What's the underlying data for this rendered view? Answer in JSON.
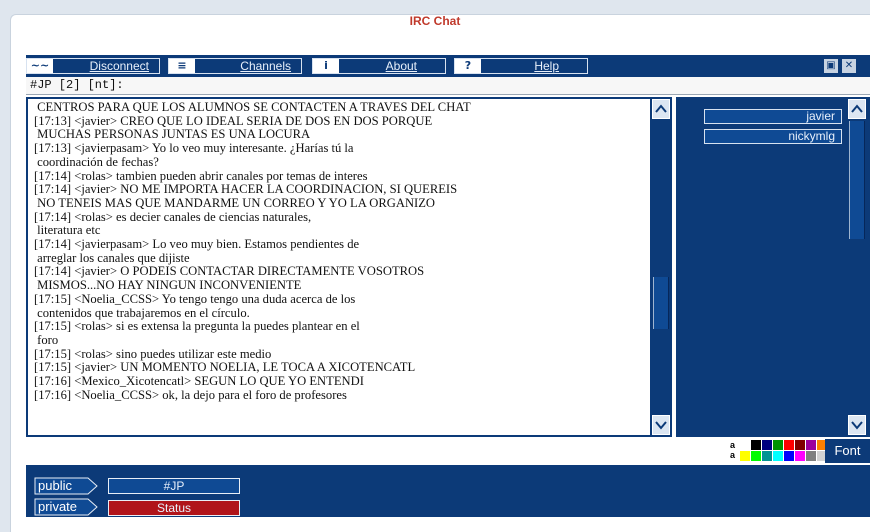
{
  "app": {
    "title": "IRC Chat"
  },
  "toolbar": {
    "disconnect": {
      "label": "Disconnect",
      "glyph": "~~"
    },
    "channels": {
      "label": "Channels",
      "glyph": "≡"
    },
    "about": {
      "label": "About",
      "glyph": "i"
    },
    "help": {
      "label": "Help",
      "glyph": "?"
    },
    "restore_glyph": "▣",
    "close_glyph": "✕"
  },
  "channel_bar": {
    "text": "#JP [2] [nt]:"
  },
  "messages": [
    " CENTROS PARA QUE LOS ALUMNOS SE CONTACTEN A TRAVES DEL CHAT",
    "[17:13] <javier> CREO QUE LO IDEAL SERIA DE DOS EN DOS PORQUE",
    " MUCHAS PERSONAS JUNTAS ES UNA LOCURA",
    "[17:13] <javierpasam> Yo lo veo muy interesante. ¿Harías tú la",
    " coordinación de fechas?",
    "[17:14] <rolas> tambien pueden abrir canales por temas de interes",
    "[17:14] <javier> NO ME IMPORTA HACER LA COORDINACION, SI QUEREIS",
    " NO TENEIS MAS QUE MANDARME UN CORREO Y YO LA ORGANIZO",
    "[17:14] <rolas> es decier canales de ciencias naturales,",
    " literatura etc",
    "[17:14] <javierpasam> Lo veo muy bien. Estamos pendientes de",
    " arreglar los canales que dijiste",
    "[17:14] <javier> O PODEIS CONTACTAR DIRECTAMENTE VOSOTROS",
    " MISMOS...NO HAY NINGUN INCONVENIENTE",
    "[17:15] <Noelia_CCSS> Yo tengo tengo una duda acerca de los",
    " contenidos que trabajaremos en el círculo.",
    "[17:15] <rolas> si es extensa la pregunta la puedes plantear en el",
    " foro",
    "[17:15] <rolas> sino puedes utilizar este medio",
    "[17:15] <javier> UN MOMENTO NOELIA, LE TOCA A XICOTENCATL",
    "[17:16] <Mexico_Xicotencatl> SEGUN LO QUE YO ENTENDI",
    "[17:16] <Noelia_CCSS> ok, la dejo para el foro de profesores"
  ],
  "users": [
    "javier",
    "nickymlg"
  ],
  "input": {
    "value": ""
  },
  "palette": {
    "letter_top": "a",
    "letter_bottom": "a",
    "colors_top": [
      "#ffffff",
      "#000000",
      "#00007f",
      "#009300",
      "#ff0000",
      "#7f0000",
      "#9c009c",
      "#fc7f00"
    ],
    "colors_bottom": [
      "#ffff00",
      "#00fc00",
      "#009393",
      "#00ffff",
      "#0000fc",
      "#ff00ff",
      "#7f7f7f",
      "#d2d2d2"
    ]
  },
  "font_button": {
    "label": "Font"
  },
  "bottom": {
    "public": {
      "tab_label": "public",
      "channel": "#JP"
    },
    "private": {
      "tab_label": "private",
      "channel": "Status"
    }
  },
  "colors": {
    "navy": "#0c3a78",
    "title_red": "#c0392b",
    "status_red": "#b0141a"
  }
}
